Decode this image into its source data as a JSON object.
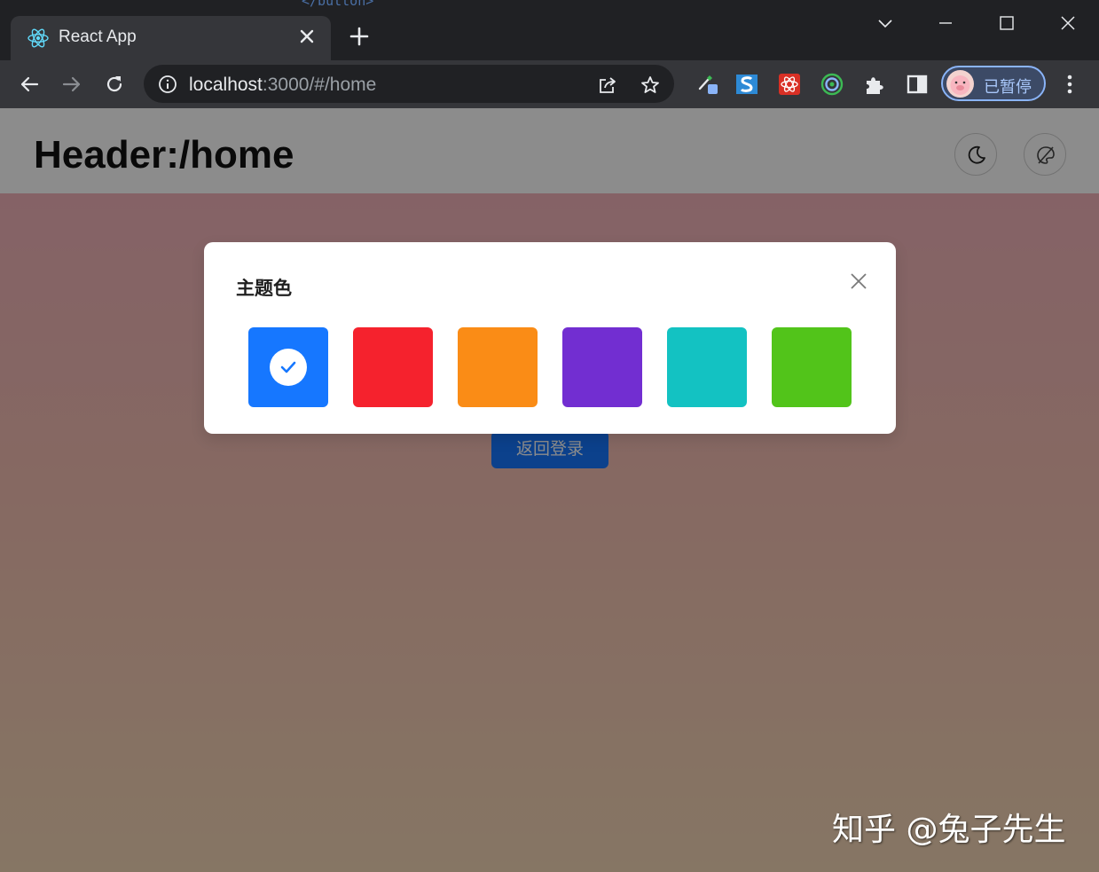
{
  "browser": {
    "behind_text": "</button>",
    "tab": {
      "title": "React App",
      "favicon": "react-icon"
    },
    "url": {
      "host": "localhost",
      "rest": ":3000/#/home"
    },
    "profile": {
      "label": "已暂停"
    }
  },
  "page": {
    "header_title": "Header:/home",
    "back_button_label": "返回登录"
  },
  "modal": {
    "title": "主题色",
    "colors": [
      {
        "name": "blue",
        "hex": "#1677ff",
        "selected": true
      },
      {
        "name": "red",
        "hex": "#f5222d",
        "selected": false
      },
      {
        "name": "orange",
        "hex": "#fa8c16",
        "selected": false
      },
      {
        "name": "purple",
        "hex": "#722ed1",
        "selected": false
      },
      {
        "name": "cyan",
        "hex": "#13c2c2",
        "selected": false
      },
      {
        "name": "green",
        "hex": "#52c41a",
        "selected": false
      }
    ]
  },
  "watermark": "知乎 @兔子先生"
}
